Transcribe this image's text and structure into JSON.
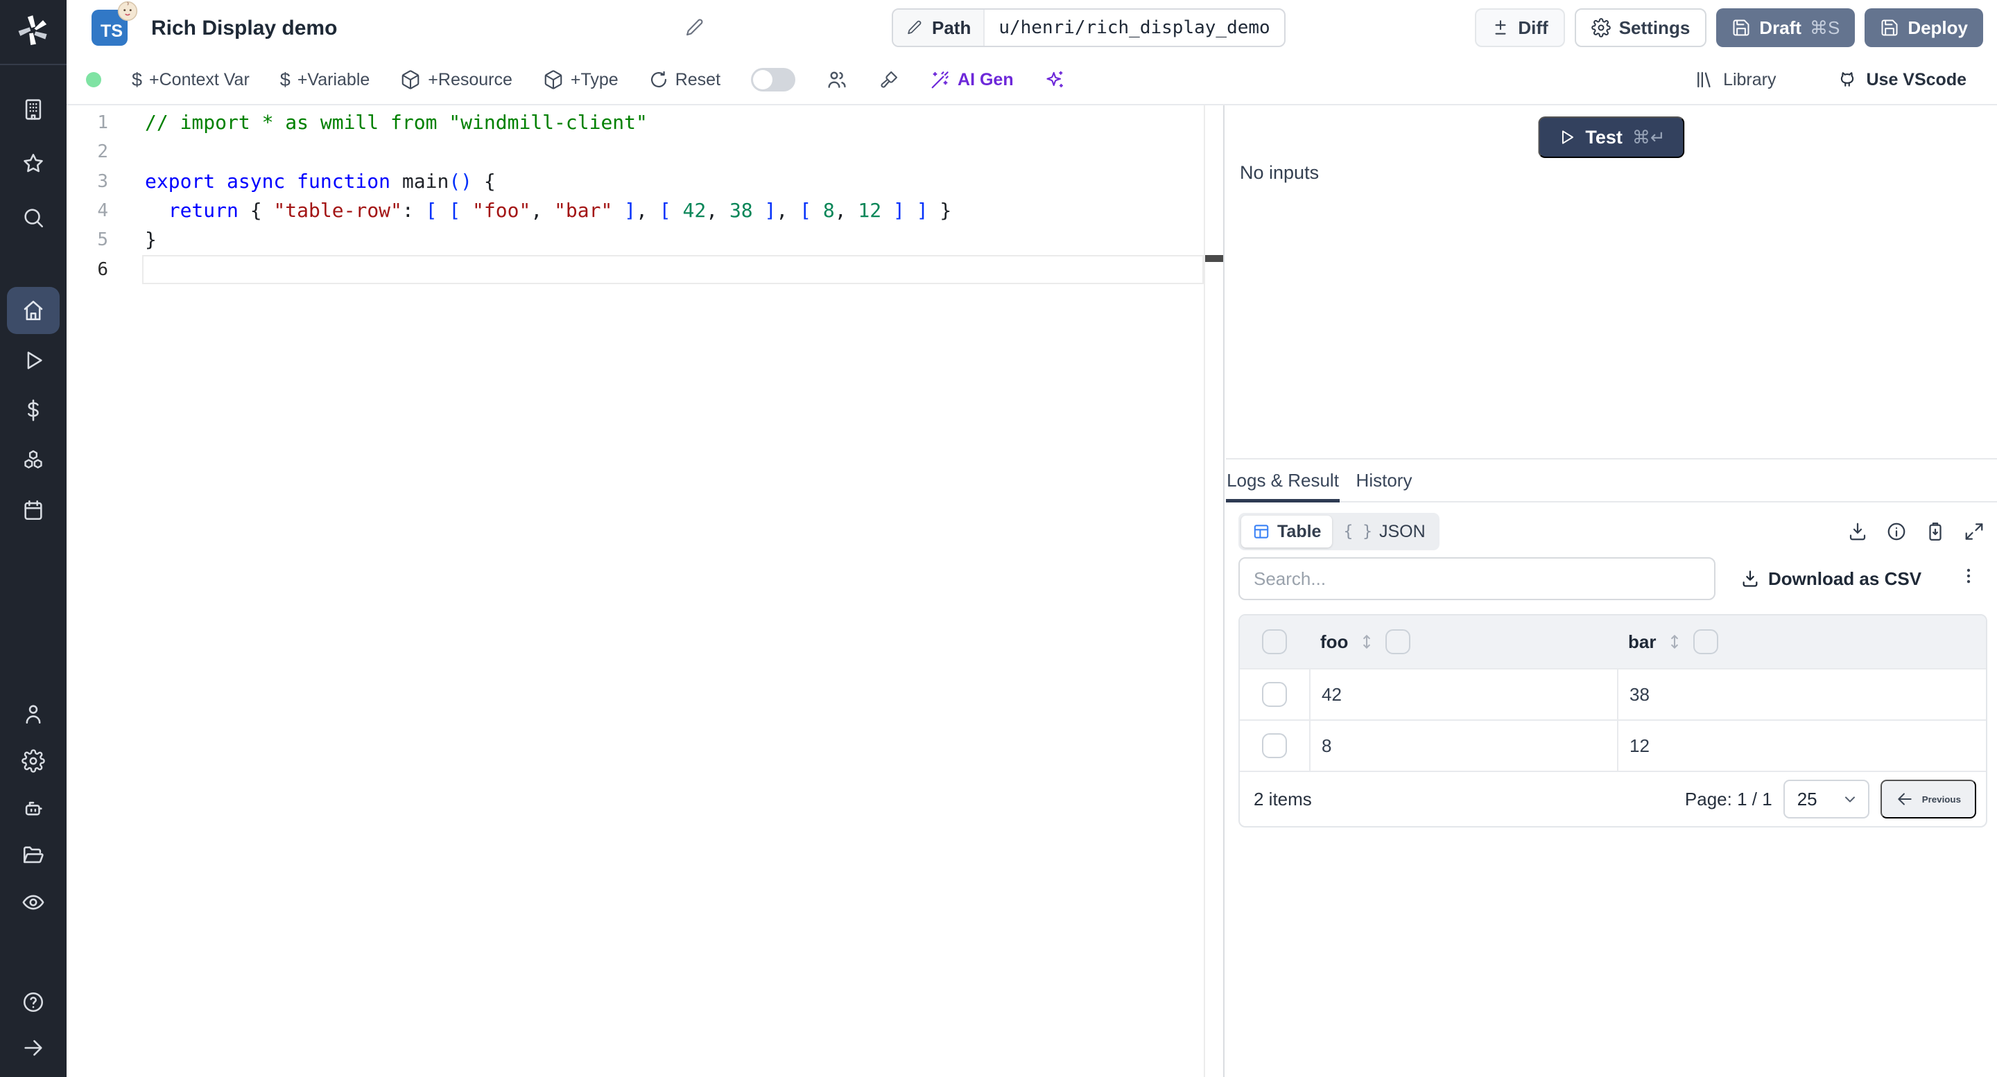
{
  "colors": {
    "sidebar_bg": "#20252e",
    "sidebar_active": "#3d4c68",
    "accent_blue": "#3178c6",
    "slate_button": "#64748f",
    "test_button": "#33415e",
    "ai_purple": "#6d28d9",
    "status_green": "#7fe3a3",
    "table_header_bg": "#f0f2f5"
  },
  "sidebar": {
    "items": [
      "windmill-logo",
      "workspace",
      "favorites",
      "search",
      "home",
      "runs",
      "variables",
      "resources",
      "schedules",
      "users",
      "settings",
      "workers",
      "folders",
      "audit-logs",
      "help",
      "expand"
    ]
  },
  "header": {
    "lang_badge": "TS",
    "title": "Rich Display demo",
    "path_label": "Path",
    "path_value": "u/henri/rich_display_demo",
    "diff": "Diff",
    "settings": "Settings",
    "draft": "Draft",
    "draft_shortcut": "⌘S",
    "deploy": "Deploy"
  },
  "toolbar": {
    "items": [
      "+Context Var",
      "+Variable",
      "+Resource",
      "+Type",
      "Reset"
    ],
    "ai_gen": "AI Gen",
    "library": "Library",
    "use_vscode": "Use VScode"
  },
  "editor": {
    "lines": [
      {
        "n": "1",
        "tokens": [
          [
            "cm",
            "// import * as wmill from \"windmill-client\""
          ]
        ]
      },
      {
        "n": "2",
        "tokens": []
      },
      {
        "n": "3",
        "tokens": [
          [
            "kw",
            "export async function "
          ],
          [
            "fn",
            "main"
          ],
          [
            "br",
            "()"
          ],
          [
            "pl",
            " {"
          ]
        ]
      },
      {
        "n": "4",
        "tokens": [
          [
            "pl",
            "  "
          ],
          [
            "kw",
            "return"
          ],
          [
            "pl",
            " { "
          ],
          [
            "str",
            "\"table-row\""
          ],
          [
            "pl",
            ": "
          ],
          [
            "br",
            "[ "
          ],
          [
            "br",
            "[ "
          ],
          [
            "str",
            "\"foo\""
          ],
          [
            "pl",
            ", "
          ],
          [
            "str",
            "\"bar\""
          ],
          [
            "br",
            " ]"
          ],
          [
            "pl",
            ", "
          ],
          [
            "br",
            "[ "
          ],
          [
            "num",
            "42"
          ],
          [
            "pl",
            ", "
          ],
          [
            "num",
            "38"
          ],
          [
            "br",
            " ]"
          ],
          [
            "pl",
            ", "
          ],
          [
            "br",
            "[ "
          ],
          [
            "num",
            "8"
          ],
          [
            "pl",
            ", "
          ],
          [
            "num",
            "12"
          ],
          [
            "br",
            " ]"
          ],
          [
            "br",
            " ]"
          ],
          [
            "pl",
            " }"
          ]
        ]
      },
      {
        "n": "5",
        "tokens": [
          [
            "pl",
            "}"
          ]
        ]
      },
      {
        "n": "6",
        "tokens": [],
        "active": true
      }
    ]
  },
  "run": {
    "test": "Test",
    "shortcut": "⌘↵",
    "no_inputs": "No inputs"
  },
  "result": {
    "tabs": [
      "Logs & Result",
      "History"
    ],
    "active_tab": "Logs & Result",
    "view_table": "Table",
    "view_json": "JSON",
    "json_glyph": "{ }",
    "search_placeholder": "Search...",
    "download_csv": "Download as CSV",
    "table": {
      "columns": [
        "foo",
        "bar"
      ],
      "rows": [
        [
          "42",
          "38"
        ],
        [
          "8",
          "12"
        ]
      ]
    },
    "footer": {
      "count": "2 items",
      "page": "Page: 1 / 1",
      "page_size": "25",
      "previous": "Previous"
    }
  }
}
